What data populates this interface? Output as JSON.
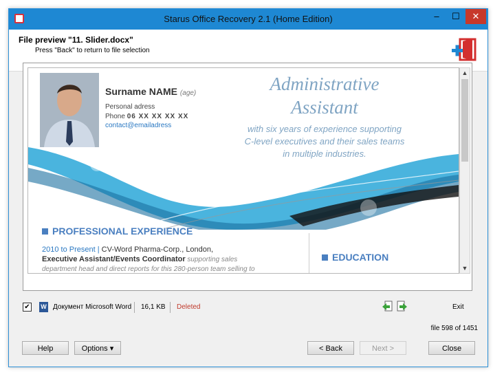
{
  "window": {
    "title": "Starus Office Recovery 2.1 (Home Edition)",
    "min": "–",
    "max": "☐",
    "close": "✕"
  },
  "header": {
    "title": "File preview \"11. Slider.docx\"",
    "subtitle": "Press \"Back\" to return to file selection"
  },
  "doc": {
    "name": "Surname NAME",
    "age": "(age)",
    "address": "Personal adress",
    "phone_label": "Phone",
    "phone": "06 XX XX XX XX",
    "email": "contact@emailadress",
    "role_line1": "Administrative",
    "role_line2": "Assistant",
    "summary_line1": "with six years of experience supporting",
    "summary_line2": "C-level executives and their sales teams",
    "summary_line3": "in multiple industries.",
    "section_experience": "PROFESSIONAL EXPERIENCE",
    "section_education": "EDUCATION",
    "exp_period": "2010 to Present |",
    "exp_company": " CV-Word Pharma-Corp., London,",
    "exp_title": "Executive Assistant/Events Coordinator",
    "exp_desc1": " supporting sales",
    "exp_desc2": "department head and direct reports for this 280-person team selling to"
  },
  "status": {
    "checkbox": "✔",
    "file_type": "Документ Microsoft Word",
    "file_size": "16,1 KB",
    "state": "Deleted",
    "exit": "Exit",
    "file_count": "file 598 of 1451"
  },
  "buttons": {
    "help": "Help",
    "options": "Options ▾",
    "back": "< Back",
    "next": "Next >",
    "close": "Close"
  },
  "colors": {
    "titlebar": "#1e88d3",
    "accent": "#4a7fc0",
    "deleted": "#c0392b"
  },
  "icons": {
    "up": "▲",
    "down": "▼"
  }
}
